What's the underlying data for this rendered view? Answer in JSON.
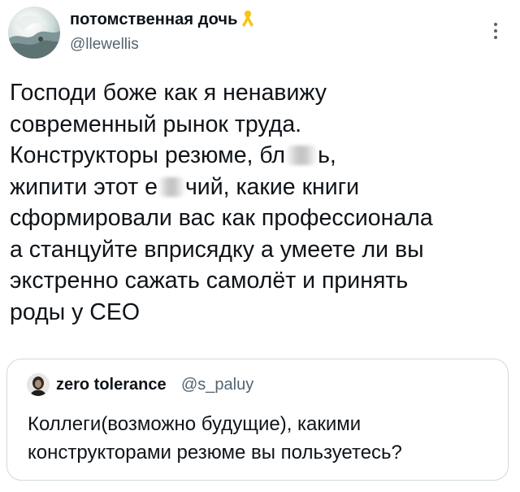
{
  "author": {
    "display_name": "потомственная дочь",
    "handle": "@llewellis",
    "badge_icon": "yellow-ribbon-icon",
    "avatar_icon": "wave-photo-avatar"
  },
  "tweet": {
    "lines": [
      "Господи боже как я ненавижу",
      "современный рынок труда.",
      "Конструкторы резюме, бл",
      "ь,",
      "жипити этот е",
      "чий, какие книги",
      "сформировали вас как профессионала",
      "а станцуйте вприсядку а умеете ли вы",
      "экстренно сажать самолёт и принять",
      "роды у CEO"
    ]
  },
  "quoted": {
    "display_name": "zero tolerance",
    "handle": "@s_paluy",
    "lines": [
      "Коллеги(возможно будущие), какими",
      "конструкторами резюме вы пользуетесь?"
    ]
  },
  "colors": {
    "text": "#0f1419",
    "muted": "#536471",
    "border": "#cfd9de",
    "ribbon": "#f5c518"
  }
}
